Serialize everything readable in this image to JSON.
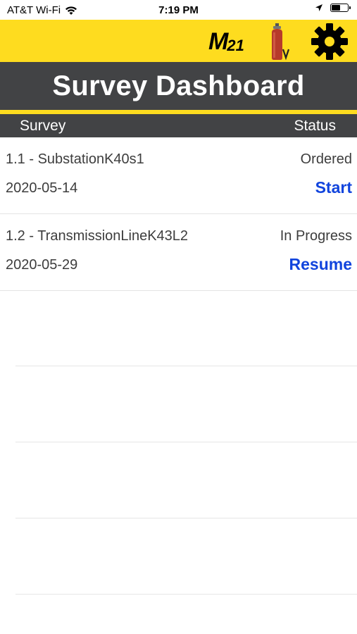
{
  "status_bar": {
    "carrier": "AT&T Wi-Fi",
    "time": "7:19 PM",
    "battery_level": 0.55
  },
  "app_bar": {
    "logo_main": "M",
    "logo_sub": "21",
    "brand_color": "#fedc1f",
    "icons": [
      "cylinder-icon",
      "gear-icon"
    ]
  },
  "title": "Survey Dashboard",
  "columns": {
    "survey": "Survey",
    "status": "Status"
  },
  "surveys": [
    {
      "name": "1.1 - SubstationK40s1",
      "date": "2020-05-14",
      "status": "Ordered",
      "action": "Start"
    },
    {
      "name": "1.2 - TransmissionLineK43L2",
      "date": "2020-05-29",
      "status": "In Progress",
      "action": "Resume"
    }
  ],
  "colors": {
    "header_dark": "#424345",
    "action_link": "#1144dd"
  }
}
